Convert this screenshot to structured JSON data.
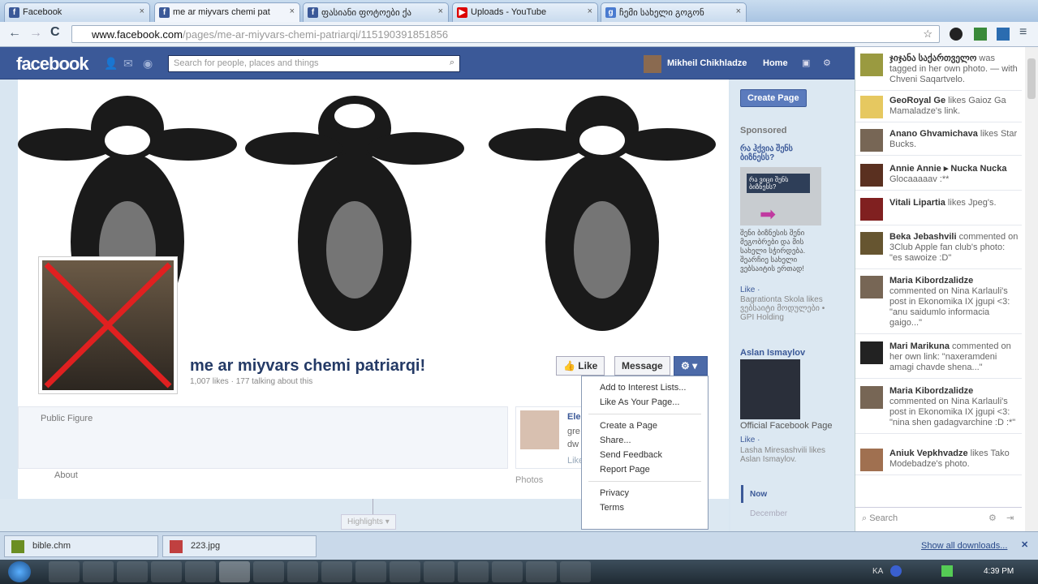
{
  "browser": {
    "tabs": [
      {
        "title": "Facebook",
        "icon": "facebook-icon"
      },
      {
        "title": "me ar miyvars chemi pat",
        "icon": "facebook-icon"
      },
      {
        "title": "ფასიანი ფოტოები ქა",
        "icon": "facebook-icon"
      },
      {
        "title": "Uploads - YouTube",
        "icon": "youtube-icon"
      },
      {
        "title": "ჩემი სახელი გოგონ",
        "icon": "google-icon"
      }
    ],
    "url_domain": "www.facebook.com",
    "url_path": "/pages/me-ar-miyvars-chemi-patriarqi/115190391851856"
  },
  "fb": {
    "logo": "facebook",
    "search_placeholder": "Search for people, places and things",
    "user": "Mikheil Chikhladze",
    "home": "Home",
    "page_title": "me ar miyvars chemi patriarqi!",
    "page_stats": "1,007 likes · 177 talking about this",
    "like": "Like",
    "message": "Message",
    "category": "Public Figure",
    "about": "About",
    "photos": "Photos",
    "highlights": "Highlights ▾",
    "post_author": "Ele",
    "post_snip1": "gre",
    "post_snip2": "dw",
    "post_like": "Like",
    "menu": [
      [
        "Add to Interest Lists...",
        "Like As Your Page..."
      ],
      [
        "Create a Page",
        "Share...",
        "Send Feedback",
        "Report Page"
      ],
      [
        "Privacy",
        "Terms"
      ]
    ],
    "right": {
      "create_page": "Create Page",
      "sponsored": "Sponsored",
      "ad1_title": "რა ჰქვია შენს ბიზნესს?",
      "ad1_img": "რა ვიცი შენს ბიზნესს?",
      "ad1_body": "შენი ბიზნესის შენი მეგობრები და მის სახელი სჭირდება. შეარჩიე სახელი ვებსაიტის ერთად!",
      "ad1_like": "Like ·",
      "ad1_social": "Bagrationta Skola likes ვებსაიტი მოდულები • GPI Holding",
      "ad2_title": "Aslan Ismaylov",
      "ad2_body": "Official Facebook Page",
      "ad2_like": "Like ·",
      "ad2_social": "Lasha Miresashvili likes Aslan Ismaylov.",
      "timeline_now": "Now",
      "timeline_dec": "December"
    },
    "ticker": [
      {
        "name": "ჯიჯანა საქართველო",
        "text": " was tagged in her own photo. — with Chveni Saqartvelo."
      },
      {
        "name": "GeoRoyal Ge",
        "text": " likes Gaioz Ga Mamaladze's link."
      },
      {
        "name": "Anano Ghvamichava",
        "text": " likes Star Bucks."
      },
      {
        "name": "Annie Annie ▸ Nucka Nucka",
        "text": " Glocaaaaav :**"
      },
      {
        "name": "Vitali Lipartia",
        "text": " likes Jpeg's."
      },
      {
        "name": "Beka Jebashvili",
        "text": " commented on 3Club Apple fan club's photo: \"es sawoize :D\""
      },
      {
        "name": "Maria Kibordzalidze",
        "text": " commented on Nina Karlauli's post in Ekonomika IX jgupi <3: \"anu saidumlo informacia gaigo...\""
      },
      {
        "name": "Mari Marikuna",
        "text": " commented on her own link: \"naxeramdeni amagi chavde shena...\""
      },
      {
        "name": "Maria Kibordzalidze",
        "text": " commented on Nina Karlauli's post in Ekonomika IX jgupi <3: \"nina shen gadagvarchine :D :*\""
      },
      {
        "name": "Aniuk Vepkhvadze",
        "text": " likes Tako Modebadze's photo."
      }
    ],
    "chat_search": "Search"
  },
  "downloads": {
    "items": [
      "bible.chm",
      "223.jpg"
    ],
    "show_all": "Show all downloads...",
    "close": "✕"
  },
  "taskbar": {
    "lang": "KA",
    "time": "4:39 PM"
  }
}
